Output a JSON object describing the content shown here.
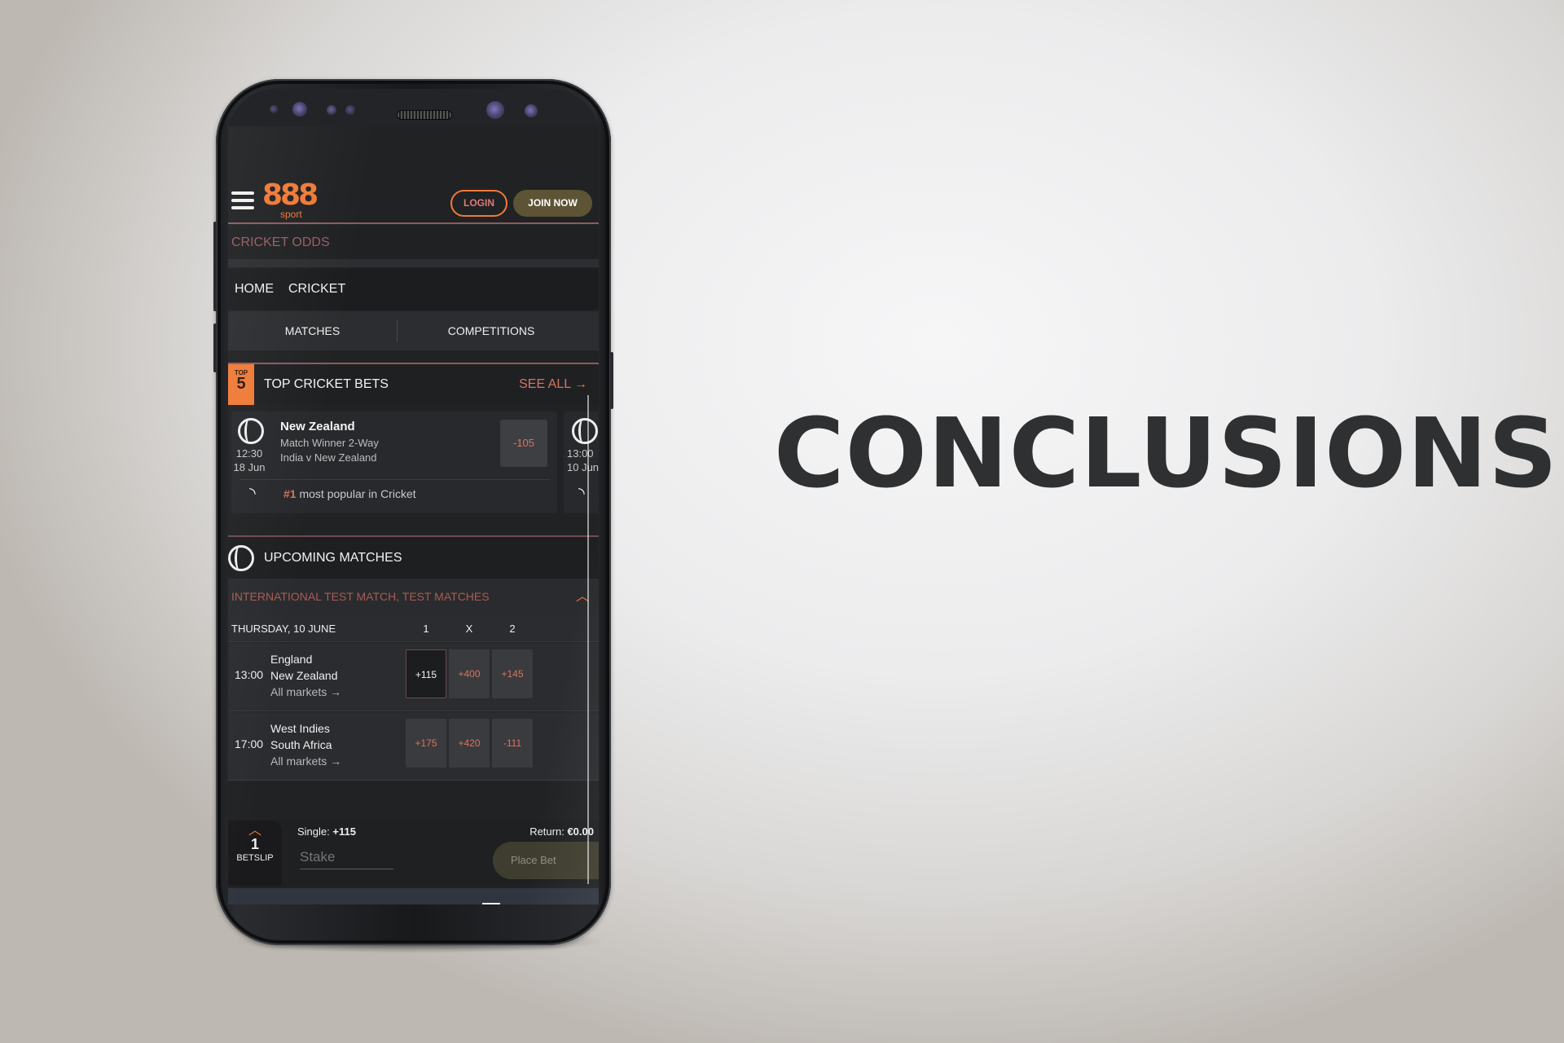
{
  "slide": {
    "heading": "CONCLUSIONS"
  },
  "app": {
    "brand": {
      "logo_number": "888",
      "logo_sub": "sport",
      "accent_color": "#f07a37"
    },
    "header": {
      "login_label": "LOGIN",
      "join_label": "JOIN NOW"
    },
    "page_title": "CRICKET ODDS",
    "breadcrumb": [
      "HOME",
      "CRICKET"
    ],
    "tabs": [
      {
        "label": "MATCHES"
      },
      {
        "label": "COMPETITIONS"
      }
    ],
    "top_bets": {
      "badge_top": "TOP",
      "badge_number": "5",
      "title": "TOP CRICKET BETS",
      "see_all": "SEE ALL",
      "cards": [
        {
          "time": "12:30",
          "date": "18 Jun",
          "selection": "New Zealand",
          "market": "Match Winner 2-Way",
          "event": "India v New Zealand",
          "odds": "-105",
          "popularity_rank": "#1",
          "popularity_text": "most popular in Cricket"
        },
        {
          "time": "13:00",
          "date": "10 Jun"
        }
      ]
    },
    "upcoming": {
      "title": "UPCOMING MATCHES",
      "competition": "INTERNATIONAL TEST MATCH, TEST MATCHES",
      "day": "THURSDAY, 10 JUNE",
      "columns": [
        "1",
        "X",
        "2"
      ],
      "matches": [
        {
          "time": "13:00",
          "home": "England",
          "away": "New Zealand",
          "link": "All markets →",
          "odds": [
            "+115",
            "+400",
            "+145"
          ],
          "selected_index": 0
        },
        {
          "time": "17:00",
          "home": "West Indies",
          "away": "South Africa",
          "link": "All markets →",
          "odds": [
            "+175",
            "+420",
            "-111"
          ],
          "selected_index": null
        }
      ]
    },
    "betslip": {
      "count": "1",
      "label": "BETSLIP",
      "single_label": "Single:",
      "single_value": "+115",
      "return_label": "Return:",
      "return_value": "€0.00",
      "stake_placeholder": "Stake",
      "place_bet": "Place Bet"
    },
    "browser_nav": {
      "tabs_count": "1"
    }
  }
}
